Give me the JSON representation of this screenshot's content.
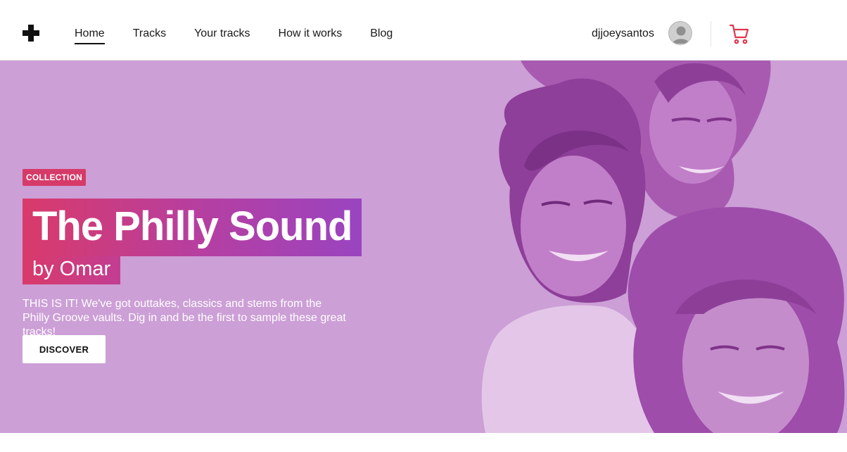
{
  "header": {
    "logo_icon": "plus-cross-logo",
    "nav": [
      {
        "label": "Home",
        "active": true
      },
      {
        "label": "Tracks",
        "active": false
      },
      {
        "label": "Your tracks",
        "active": false
      },
      {
        "label": "How it works",
        "active": false
      },
      {
        "label": "Blog",
        "active": false
      }
    ],
    "username": "djjoeysantos",
    "avatar_icon": "user-avatar-icon",
    "cart_icon": "shopping-cart-icon",
    "cart_color": "#e0364f"
  },
  "hero": {
    "background_color": "#cc9fd6",
    "badge": "COLLECTION",
    "title": "The Philly Sound",
    "byline": "by Omar",
    "description": "THIS IS IT! We've got outtakes, classics and stems from the Philly Groove vaults. Dig in and be the first to sample these great tracks!",
    "cta_label": "DISCOVER",
    "accent_pink": "#d93a6a",
    "accent_purple": "#9a44c0"
  }
}
